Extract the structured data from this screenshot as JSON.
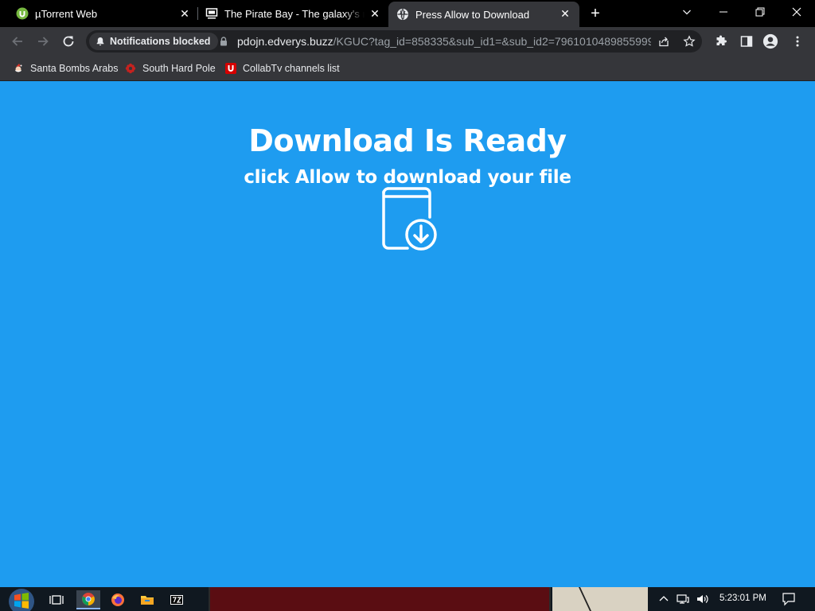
{
  "browser": {
    "tabs": [
      {
        "title": "µTorrent Web",
        "icon": "utorrent-icon",
        "active": false
      },
      {
        "title": "The Pirate Bay - The galaxy's most resilient BitTorrent site",
        "icon": "pirate-bay-icon",
        "active": false
      },
      {
        "title": "Press Allow to Download",
        "icon": "globe-icon",
        "active": true
      }
    ],
    "omnibox": {
      "notifications_chip": "Notifications blocked",
      "url_host": "pdojn.edverys.buzz",
      "url_path": "/KGUC?tag_id=858335&sub_id1=&sub_id2=7961010489855999..."
    },
    "bookmarks": [
      {
        "label": "Santa Bombs Arabs",
        "icon": "santa-icon"
      },
      {
        "label": "South Hard Pole",
        "icon": "flower-icon"
      },
      {
        "label": "CollabTv channels list",
        "icon": "collabtv-icon"
      }
    ]
  },
  "page": {
    "headline": "Download Is Ready",
    "subline": "click Allow to download your file",
    "icon": "file-download-icon",
    "background": "#1e9cf0"
  },
  "taskbar": {
    "apps": [
      "start-orb-icon",
      "task-view-icon",
      "chrome-icon",
      "firefox-icon",
      "file-explorer-icon",
      "7zip-icon"
    ],
    "clock": "5:23:01 PM"
  }
}
